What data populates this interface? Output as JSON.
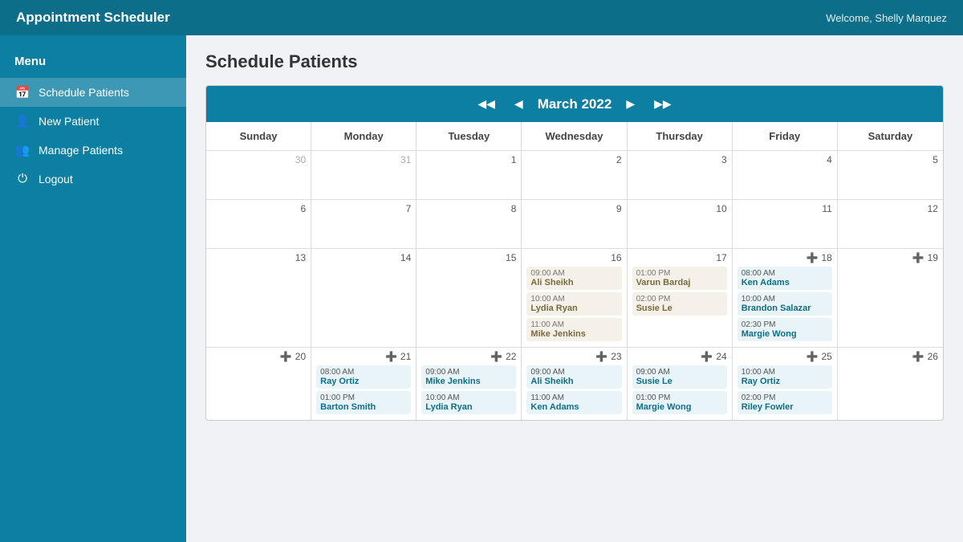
{
  "app": {
    "title": "Appointment Scheduler",
    "welcome": "Welcome, Shelly Marquez"
  },
  "sidebar": {
    "menu_label": "Menu",
    "items": [
      {
        "id": "schedule-patients",
        "label": "Schedule Patients",
        "icon": "📅",
        "active": true
      },
      {
        "id": "new-patient",
        "label": "New Patient",
        "icon": "👤+",
        "active": false
      },
      {
        "id": "manage-patients",
        "label": "Manage Patients",
        "icon": "👥",
        "active": false
      },
      {
        "id": "logout",
        "label": "Logout",
        "icon": "⏻",
        "active": false
      }
    ]
  },
  "page": {
    "title": "Schedule Patients"
  },
  "calendar": {
    "month_label": "March 2022",
    "day_headers": [
      "Sunday",
      "Monday",
      "Tuesday",
      "Wednesday",
      "Thursday",
      "Friday",
      "Saturday"
    ],
    "nav": {
      "prev_prev": "◀◀",
      "prev": "◀",
      "next": "▶",
      "next_next": "▶▶"
    },
    "rows": [
      {
        "cells": [
          {
            "day": "30",
            "other_month": true,
            "add": false,
            "appts": []
          },
          {
            "day": "31",
            "other_month": true,
            "add": false,
            "appts": []
          },
          {
            "day": "1",
            "other_month": false,
            "add": false,
            "appts": []
          },
          {
            "day": "2",
            "other_month": false,
            "add": false,
            "appts": []
          },
          {
            "day": "3",
            "other_month": false,
            "add": false,
            "appts": []
          },
          {
            "day": "4",
            "other_month": false,
            "add": false,
            "appts": []
          },
          {
            "day": "5",
            "other_month": false,
            "add": false,
            "appts": []
          }
        ]
      },
      {
        "cells": [
          {
            "day": "6",
            "other_month": false,
            "add": false,
            "appts": []
          },
          {
            "day": "7",
            "other_month": false,
            "add": false,
            "appts": []
          },
          {
            "day": "8",
            "other_month": false,
            "add": false,
            "appts": []
          },
          {
            "day": "9",
            "other_month": false,
            "add": false,
            "appts": []
          },
          {
            "day": "10",
            "other_month": false,
            "add": false,
            "appts": []
          },
          {
            "day": "11",
            "other_month": false,
            "add": false,
            "appts": []
          },
          {
            "day": "12",
            "other_month": false,
            "add": false,
            "appts": []
          }
        ]
      },
      {
        "cells": [
          {
            "day": "13",
            "other_month": false,
            "add": false,
            "appts": []
          },
          {
            "day": "14",
            "other_month": false,
            "add": false,
            "appts": []
          },
          {
            "day": "15",
            "other_month": false,
            "add": false,
            "appts": []
          },
          {
            "day": "16",
            "other_month": false,
            "add": false,
            "appts": [
              {
                "time": "09:00 AM",
                "name": "Ali Sheikh",
                "style": "beige"
              },
              {
                "time": "10:00 AM",
                "name": "Lydia Ryan",
                "style": "beige"
              },
              {
                "time": "11:00 AM",
                "name": "Mike Jenkins",
                "style": "beige"
              }
            ]
          },
          {
            "day": "17",
            "other_month": false,
            "add": false,
            "appts": [
              {
                "time": "01:00 PM",
                "name": "Varun Bardaj",
                "style": "beige"
              },
              {
                "time": "02:00 PM",
                "name": "Susie Le",
                "style": "beige"
              }
            ]
          },
          {
            "day": "18",
            "other_month": false,
            "add": true,
            "appts": [
              {
                "time": "08:00 AM",
                "name": "Ken Adams",
                "style": "blue"
              },
              {
                "time": "10:00 AM",
                "name": "Brandon Salazar",
                "style": "blue"
              },
              {
                "time": "02:30 PM",
                "name": "Margie Wong",
                "style": "blue"
              }
            ]
          },
          {
            "day": "19",
            "other_month": false,
            "add": true,
            "appts": []
          }
        ]
      },
      {
        "cells": [
          {
            "day": "20",
            "other_month": false,
            "add": true,
            "appts": []
          },
          {
            "day": "21",
            "other_month": false,
            "add": true,
            "appts": [
              {
                "time": "08:00 AM",
                "name": "Ray Ortiz",
                "style": "blue"
              },
              {
                "time": "01:00 PM",
                "name": "Barton Smith",
                "style": "blue"
              }
            ]
          },
          {
            "day": "22",
            "other_month": false,
            "add": true,
            "appts": [
              {
                "time": "09:00 AM",
                "name": "Mike Jenkins",
                "style": "blue"
              },
              {
                "time": "10:00 AM",
                "name": "Lydia Ryan",
                "style": "blue"
              }
            ]
          },
          {
            "day": "23",
            "other_month": false,
            "add": true,
            "appts": [
              {
                "time": "09:00 AM",
                "name": "Ali Sheikh",
                "style": "blue"
              },
              {
                "time": "11:00 AM",
                "name": "Ken Adams",
                "style": "blue"
              }
            ]
          },
          {
            "day": "24",
            "other_month": false,
            "add": true,
            "appts": [
              {
                "time": "09:00 AM",
                "name": "Susie Le",
                "style": "blue"
              },
              {
                "time": "01:00 PM",
                "name": "Margie Wong",
                "style": "blue"
              }
            ]
          },
          {
            "day": "25",
            "other_month": false,
            "add": true,
            "appts": [
              {
                "time": "10:00 AM",
                "name": "Ray Ortiz",
                "style": "blue"
              },
              {
                "time": "02:00 PM",
                "name": "Riley Fowler",
                "style": "blue"
              }
            ]
          },
          {
            "day": "26",
            "other_month": false,
            "add": true,
            "appts": []
          }
        ]
      }
    ]
  }
}
